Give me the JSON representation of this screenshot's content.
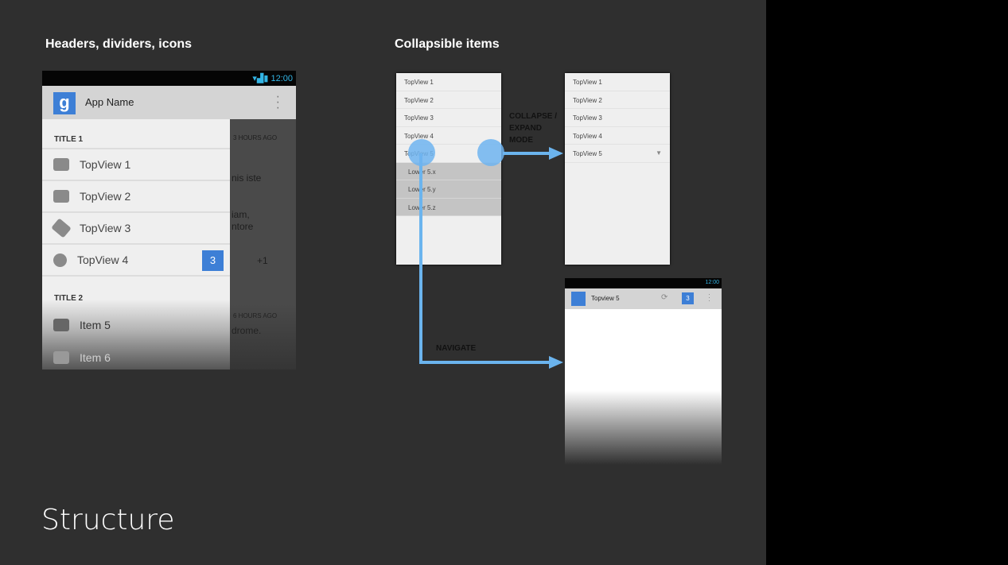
{
  "slide": {
    "title": "Structure",
    "left_heading": "Headers, dividers, icons",
    "right_heading": "Collapsible items",
    "accent": "#6bb4ee"
  },
  "phone": {
    "time": "12:00",
    "app_name": "App Name",
    "logo": "g",
    "sections": [
      {
        "title": "TITLE 1",
        "items": [
          {
            "label": "TopView 1",
            "icon": "inbox-icon"
          },
          {
            "label": "TopView 2",
            "icon": "people-icon"
          },
          {
            "label": "TopView 3",
            "icon": "tag-icon"
          },
          {
            "label": "TopView 4",
            "icon": "info-icon",
            "badge": "3"
          }
        ]
      },
      {
        "title": "TITLE 2",
        "items": [
          {
            "label": "Item 5",
            "icon": "inbox-icon"
          },
          {
            "label": "Item 6",
            "icon": "inbox-icon"
          }
        ]
      }
    ],
    "background_text": [
      "3 HOURS AGO",
      "nis iste",
      "iam,",
      "ntore",
      "+1",
      "6 HOURS AGO",
      "drome."
    ]
  },
  "expanded_list": {
    "items": [
      "TopView 1",
      "TopView 2",
      "TopView 3",
      "TopView 4",
      "TopView 5"
    ],
    "children": [
      "Lower 5.x",
      "Lower 5.y",
      "Lower 5.z"
    ]
  },
  "collapsed_list": {
    "items": [
      "TopView 1",
      "TopView 2",
      "TopView 3",
      "TopView 4",
      "TopView 5"
    ]
  },
  "labels": {
    "collapse": "COLLAPSE / EXPAND MODE",
    "navigate": "NAVIGATE"
  },
  "detail_phone": {
    "time": "12:00",
    "title": "Topview 5",
    "badge": "3"
  }
}
